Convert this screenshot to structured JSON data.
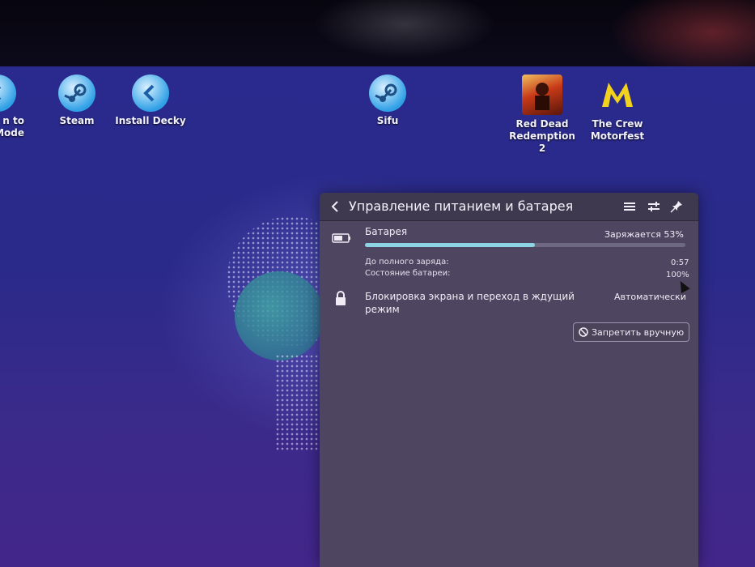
{
  "desktop": {
    "icons": [
      {
        "label_line1": "n to",
        "label_line2": "Mode",
        "icon": "return-arrow-icon"
      },
      {
        "label_line1": "Steam",
        "label_line2": "",
        "icon": "steam-icon"
      },
      {
        "label_line1": "Install Decky",
        "label_line2": "",
        "icon": "decky-icon"
      },
      {
        "label_line1": "Sifu",
        "label_line2": "",
        "icon": "steam-icon"
      },
      {
        "label_line1": "Red Dead",
        "label_line2": "Redemption 2",
        "icon": "rdr2-icon"
      },
      {
        "label_line1": "The Crew",
        "label_line2": "Motorfest",
        "icon": "crew-icon"
      }
    ]
  },
  "panel": {
    "title": "Управление питанием и батарея",
    "battery": {
      "label": "Батарея",
      "status": "Заряжается 53%",
      "level_percent": 53,
      "time_label": "До полного заряда:",
      "time_value": "0:57",
      "health_label": "Состояние батареи:",
      "health_value": "100%"
    },
    "lock": {
      "label_line1": "Блокировка экрана и переход в ждущий",
      "label_line2": "режим",
      "mode": "Автоматически"
    },
    "ban_button_label": "Запретить вручную"
  },
  "colors": {
    "panel_bg": "#4e4660",
    "bar_fill": "#8ed3e3",
    "desktop_bg": "#2a2a8e"
  }
}
